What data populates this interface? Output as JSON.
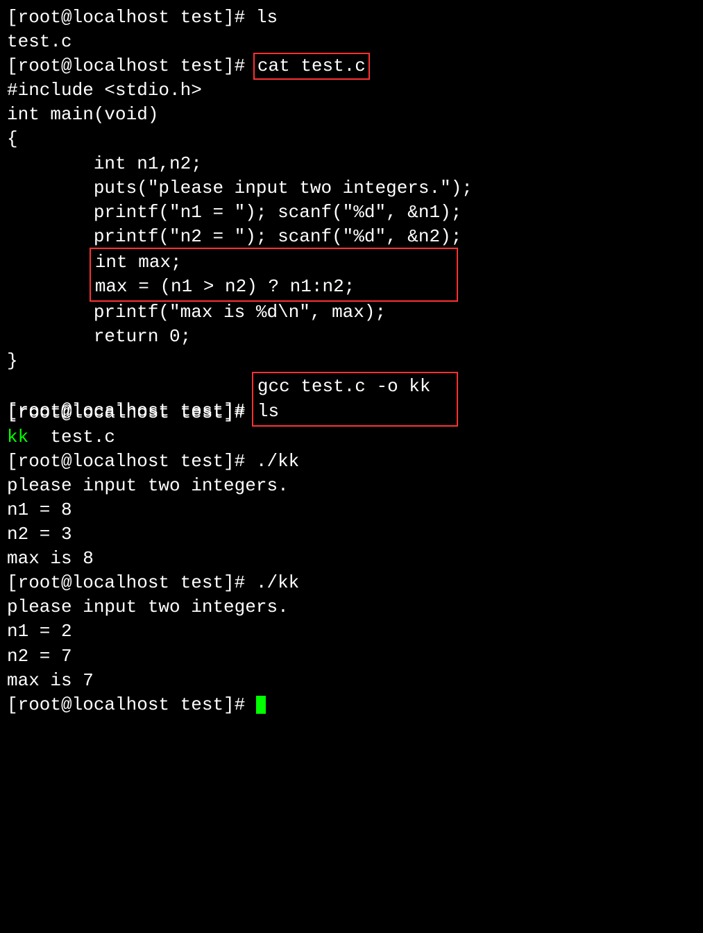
{
  "prompt": "[root@localhost test]# ",
  "cmd": {
    "ls1": "ls",
    "cat": "cat test.c",
    "gcc": "gcc test.c -o kk",
    "ls2": "ls",
    "run1": "./kk",
    "run2": "./kk"
  },
  "out": {
    "ls1": "test.c",
    "code": {
      "l1": "#include <stdio.h>",
      "l2": "",
      "l3": "int main(void)",
      "l4": "{",
      "l5": "        int n1,n2;",
      "l6": "",
      "l7": "        puts(\"please input two integers.\");",
      "l8": "        printf(\"n1 = \"); scanf(\"%d\", &n1);",
      "l9": "        printf(\"n2 = \"); scanf(\"%d\", &n2);",
      "l10": "",
      "boxed1": "int max;",
      "boxed2": "max = (n1 > n2) ? n1:n2;",
      "l13": "",
      "l14": "        printf(\"max is %d\\n\", max);",
      "l15": "",
      "l16": "        return 0;",
      "l17": "}"
    },
    "ls2": {
      "green": "kk",
      "rest": "  test.c"
    },
    "run1": {
      "r1": "please input two integers.",
      "r2": "n1 = 8",
      "r3": "n2 = 3",
      "r4": "max is 8"
    },
    "run2": {
      "r1": "please input two integers.",
      "r2": "n1 = 2",
      "r3": "n2 = 7",
      "r4": "max is 7"
    }
  }
}
